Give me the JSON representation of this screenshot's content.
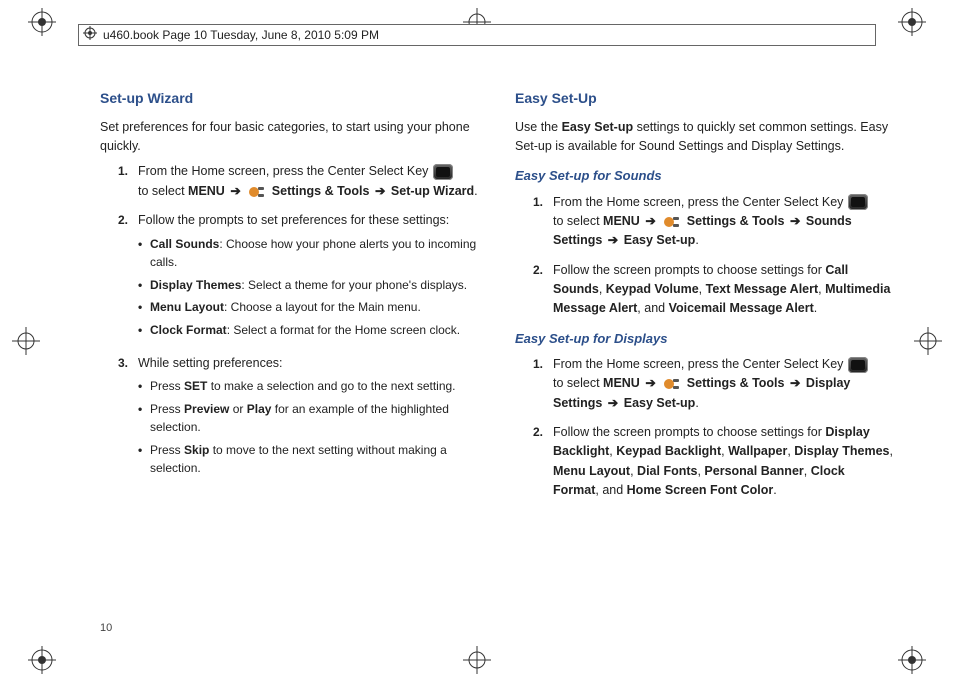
{
  "header": {
    "text": "u460.book  Page 10  Tuesday, June 8, 2010  5:09 PM"
  },
  "pageNumber": "10",
  "left": {
    "title": "Set-up Wizard",
    "intro": "Set preferences for four basic categories, to start using your phone quickly.",
    "step1_a": "From the Home screen, press the Center Select Key ",
    "step1_b": "to select ",
    "step1_menu": "MENU",
    "step1_arrow": "➔",
    "step1_tools": " Settings & Tools ",
    "step1_arrow2": "➔",
    "step1_target": " Set-up Wizard",
    "step2": "Follow the prompts to set preferences for these settings:",
    "b1_label": "Call Sounds",
    "b1_rest": ": Choose how your phone alerts you to incoming calls.",
    "b2_label": "Display Themes",
    "b2_rest": ": Select a theme for your phone's displays.",
    "b3_label": "Menu Layout",
    "b3_rest": ": Choose a layout for the Main menu.",
    "b4_label": "Clock Format",
    "b4_rest": ": Select a format for the Home screen clock.",
    "step3": "While setting preferences:",
    "b5_pre": "Press  ",
    "b5_label": "SET",
    "b5_rest": " to make a selection and go to the next setting.",
    "b6_pre": "Press ",
    "b6_label1": "Preview",
    "b6_mid": " or ",
    "b6_label2": "Play",
    "b6_rest": " for an example of the highlighted selection.",
    "b7_pre": "Press ",
    "b7_label": "Skip",
    "b7_rest": " to move to the next setting without making a selection."
  },
  "right": {
    "title": "Easy Set-Up",
    "intro1": "Use the ",
    "intro_bold": "Easy Set-up",
    "intro2": " settings to quickly set common settings. Easy Set-up is available for Sound Settings and Display Settings.",
    "sounds_title": "Easy Set-up for Sounds",
    "s1_a": "From the Home screen, press the Center Select Key ",
    "s1_b": "to select ",
    "menu": "MENU",
    "arrow": "➔",
    "tools": " Settings & Tools ",
    "s1_sounds": " Sounds Settings ",
    "s1_easy": " Easy Set-up",
    "s2_pre": "Follow the screen prompts to choose settings for ",
    "s2_b1": "Call Sounds",
    "s2_c1": ", ",
    "s2_b2": "Keypad Volume",
    "s2_c2": ", ",
    "s2_b3": "Text Message Alert",
    "s2_c3": ", ",
    "s2_b4": "Multimedia Message Alert",
    "s2_c4": ", and ",
    "s2_b5": "Voicemail Message Alert",
    "s2_end": ".",
    "displays_title": "Easy Set-up for Displays",
    "d1_a": "From the Home screen, press the Center Select Key ",
    "d1_b": "to select ",
    "d1_disp": " Display Settings ",
    "d1_easy": " Easy Set-up",
    "d2_pre": "Follow the screen prompts to choose settings for ",
    "d2_b1": "Display Backlight",
    "d2_c1": ", ",
    "d2_b2": "Keypad Backlight",
    "d2_c2": ", ",
    "d2_b3": "Wallpaper",
    "d2_c3": ", ",
    "d2_b4": "Display Themes",
    "d2_c4": ", ",
    "d2_b5": "Menu Layout",
    "d2_c5": ", ",
    "d2_b6": "Dial Fonts",
    "d2_c6": ", ",
    "d2_b7": "Personal Banner",
    "d2_c7": ", ",
    "d2_b8": "Clock Format",
    "d2_c8": ", and ",
    "d2_b9": "Home Screen Font Color",
    "d2_end": "."
  }
}
